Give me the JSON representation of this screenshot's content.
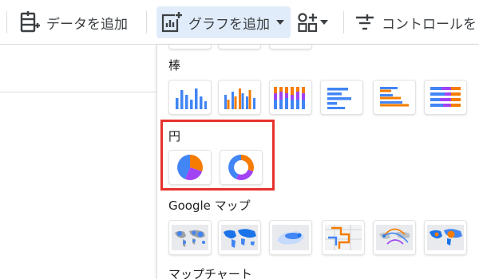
{
  "toolbar": {
    "add_data_label": "データを追加",
    "add_chart_label": "グラフを追加",
    "add_control_label": "コントロールを"
  },
  "menu": {
    "sections": {
      "bar": "棒",
      "pie": "円",
      "geo": "Google マップ",
      "map": "マップチャート"
    }
  },
  "colors": {
    "blue": "#4285f4",
    "orange": "#f57c00",
    "purple": "#a142f4",
    "highlight": "#e6322b"
  },
  "icons": {
    "add_data": "database-add-icon",
    "add_chart": "chart-add-icon",
    "community": "shapes-add-icon",
    "control": "filter-list-icon"
  }
}
